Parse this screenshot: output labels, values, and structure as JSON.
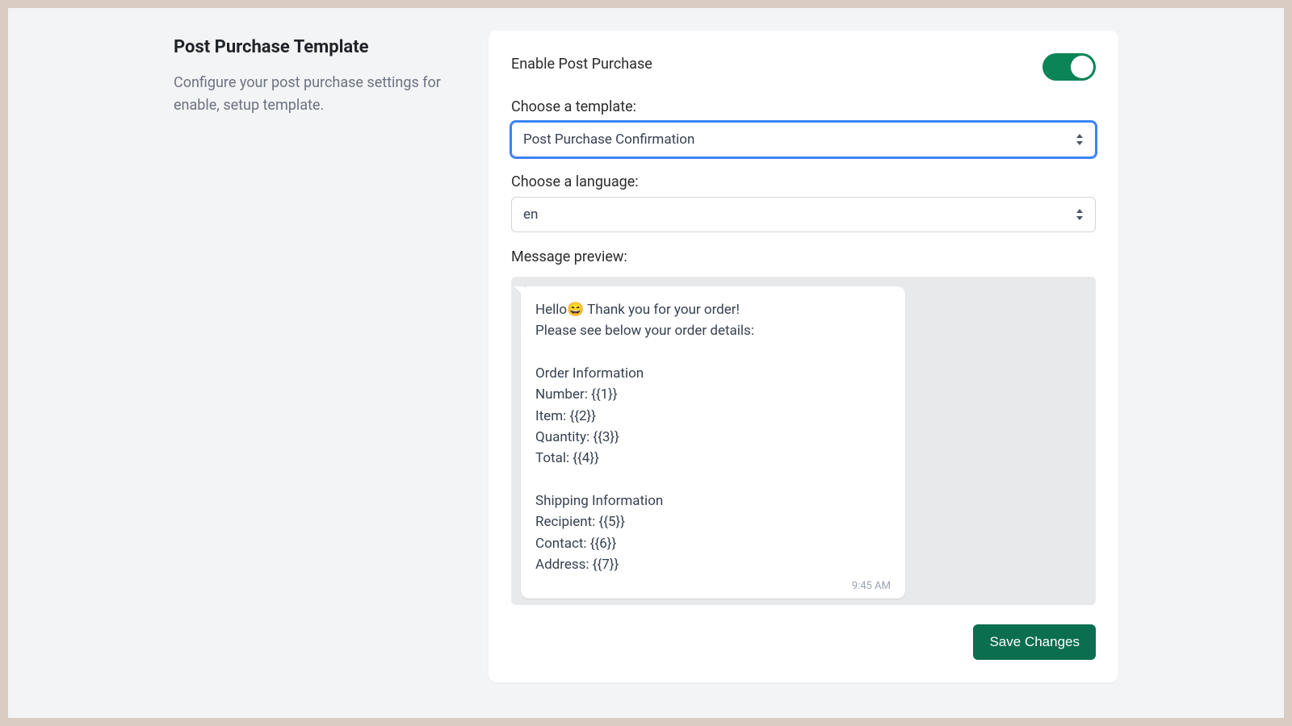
{
  "left": {
    "title": "Post Purchase Template",
    "description": "Configure your post purchase settings for enable, setup template."
  },
  "form": {
    "enable_label": "Enable Post Purchase",
    "enable_value": true,
    "template_label": "Choose a template:",
    "template_value": "Post Purchase Confirmation",
    "language_label": "Choose a language:",
    "language_value": "en",
    "preview_label": "Message preview:",
    "message_text": "Hello😄 Thank you for your order!\nPlease see below your order details:\n\nOrder Information\nNumber: {{1}}\nItem: {{2}}\nQuantity: {{3}}\nTotal: {{4}}\n\nShipping Information\nRecipient: {{5}}\nContact: {{6}}\nAddress: {{7}}",
    "message_time": "9:45 AM",
    "save_label": "Save Changes"
  },
  "colors": {
    "accent": "#0b8457",
    "primary_button": "#0b6e4f",
    "focus_ring": "#3b82f6"
  }
}
